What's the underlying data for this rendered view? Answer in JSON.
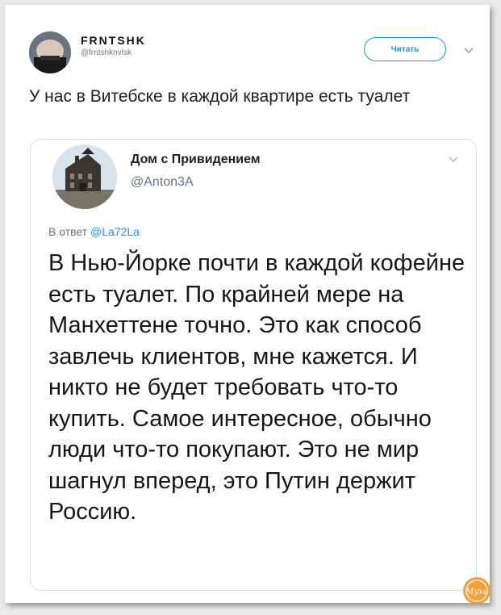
{
  "tweet": {
    "display_name": "FRNTSHK",
    "handle": "@frntshknvlsk",
    "follow_label": "Читать",
    "text": "У нас в Витебске в каждой квартире есть туалет"
  },
  "quoted_tweet": {
    "display_name": "Дом с Привидением",
    "handle": "@Anton3A",
    "reply_prefix": "В ответ",
    "reply_to": "@La72La",
    "text": "В Нью-Йорке почти в каждой кофейне есть туалет. По крайней мере на Манхеттене точно. Это как способ завлечь клиентов, мне кажется. И никто не будет требовать что-то купить. Самое интересное, обычно люди что-то покупают. Это не мир шагнул вперед, это Путин держит Россию."
  },
  "watermark": {
    "text": "Муха",
    "color": "#f2a23a"
  },
  "colors": {
    "accent": "#1b95e0",
    "secondary_text": "#657786",
    "border": "#d6dfe5"
  },
  "icons": {
    "menu": "chevron-down-icon"
  }
}
